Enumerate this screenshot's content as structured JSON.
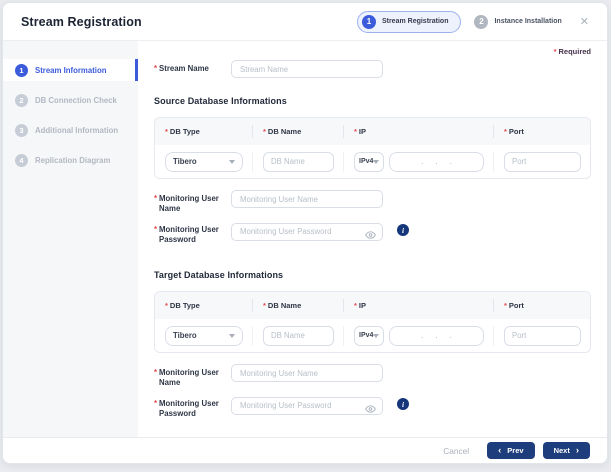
{
  "header": {
    "title": "Stream Registration",
    "steps": [
      {
        "number": "1",
        "label": "Stream Registration"
      },
      {
        "number": "2",
        "label": "Instance Installation"
      }
    ],
    "close_icon": "✕"
  },
  "sidebar": {
    "steps": [
      {
        "number": "1",
        "label": "Stream Information"
      },
      {
        "number": "2",
        "label": "DB Connection Check"
      },
      {
        "number": "3",
        "label": "Additional Information"
      },
      {
        "number": "4",
        "label": "Replication Diagram"
      }
    ]
  },
  "form": {
    "asterisk": "*",
    "required_note": "Required",
    "stream_name": {
      "label": "Stream Name",
      "placeholder": "Stream Name"
    },
    "sections": [
      {
        "title": "Source Database Informations",
        "columns": [
          {
            "label": "DB Type"
          },
          {
            "label": "DB Name"
          },
          {
            "label": "IP"
          },
          {
            "label": "Port"
          }
        ],
        "db_type_value": "Tibero",
        "db_name_placeholder": "DB Name",
        "ip_version": "IPv4",
        "ip_dots": ".  .  .",
        "port_placeholder": "Port",
        "monitoring_user_name": {
          "label": "Monitoring User\nName",
          "placeholder": "Monitoring User Name"
        },
        "monitoring_user_password": {
          "label": "Monitoring User\nPassword",
          "placeholder": "Monitoring User Password"
        },
        "info_icon_glyph": "i"
      },
      {
        "title": "Target Database Informations",
        "columns": [
          {
            "label": "DB Type"
          },
          {
            "label": "DB Name"
          },
          {
            "label": "IP"
          },
          {
            "label": "Port"
          }
        ],
        "db_type_value": "Tibero",
        "db_name_placeholder": "DB Name",
        "ip_version": "IPv4",
        "ip_dots": ".  .  .",
        "port_placeholder": "Port",
        "monitoring_user_name": {
          "label": "Monitoring User\nName",
          "placeholder": "Monitoring User Name"
        },
        "monitoring_user_password": {
          "label": "Monitoring User\nPassword",
          "placeholder": "Monitoring User Password"
        },
        "info_icon_glyph": "i"
      }
    ]
  },
  "footer": {
    "cancel_label": "Cancel",
    "prev_chevron": "‹",
    "prev_label": "Prev",
    "next_label": "Next",
    "next_chevron": "›"
  },
  "colors": {
    "accent_blue": "#3b5bdb",
    "button_navy": "#1e3d7c",
    "required_red": "#e5484d",
    "sidebar_bg": "#f6f7f9",
    "table_header_bg": "#f7f8fa"
  }
}
